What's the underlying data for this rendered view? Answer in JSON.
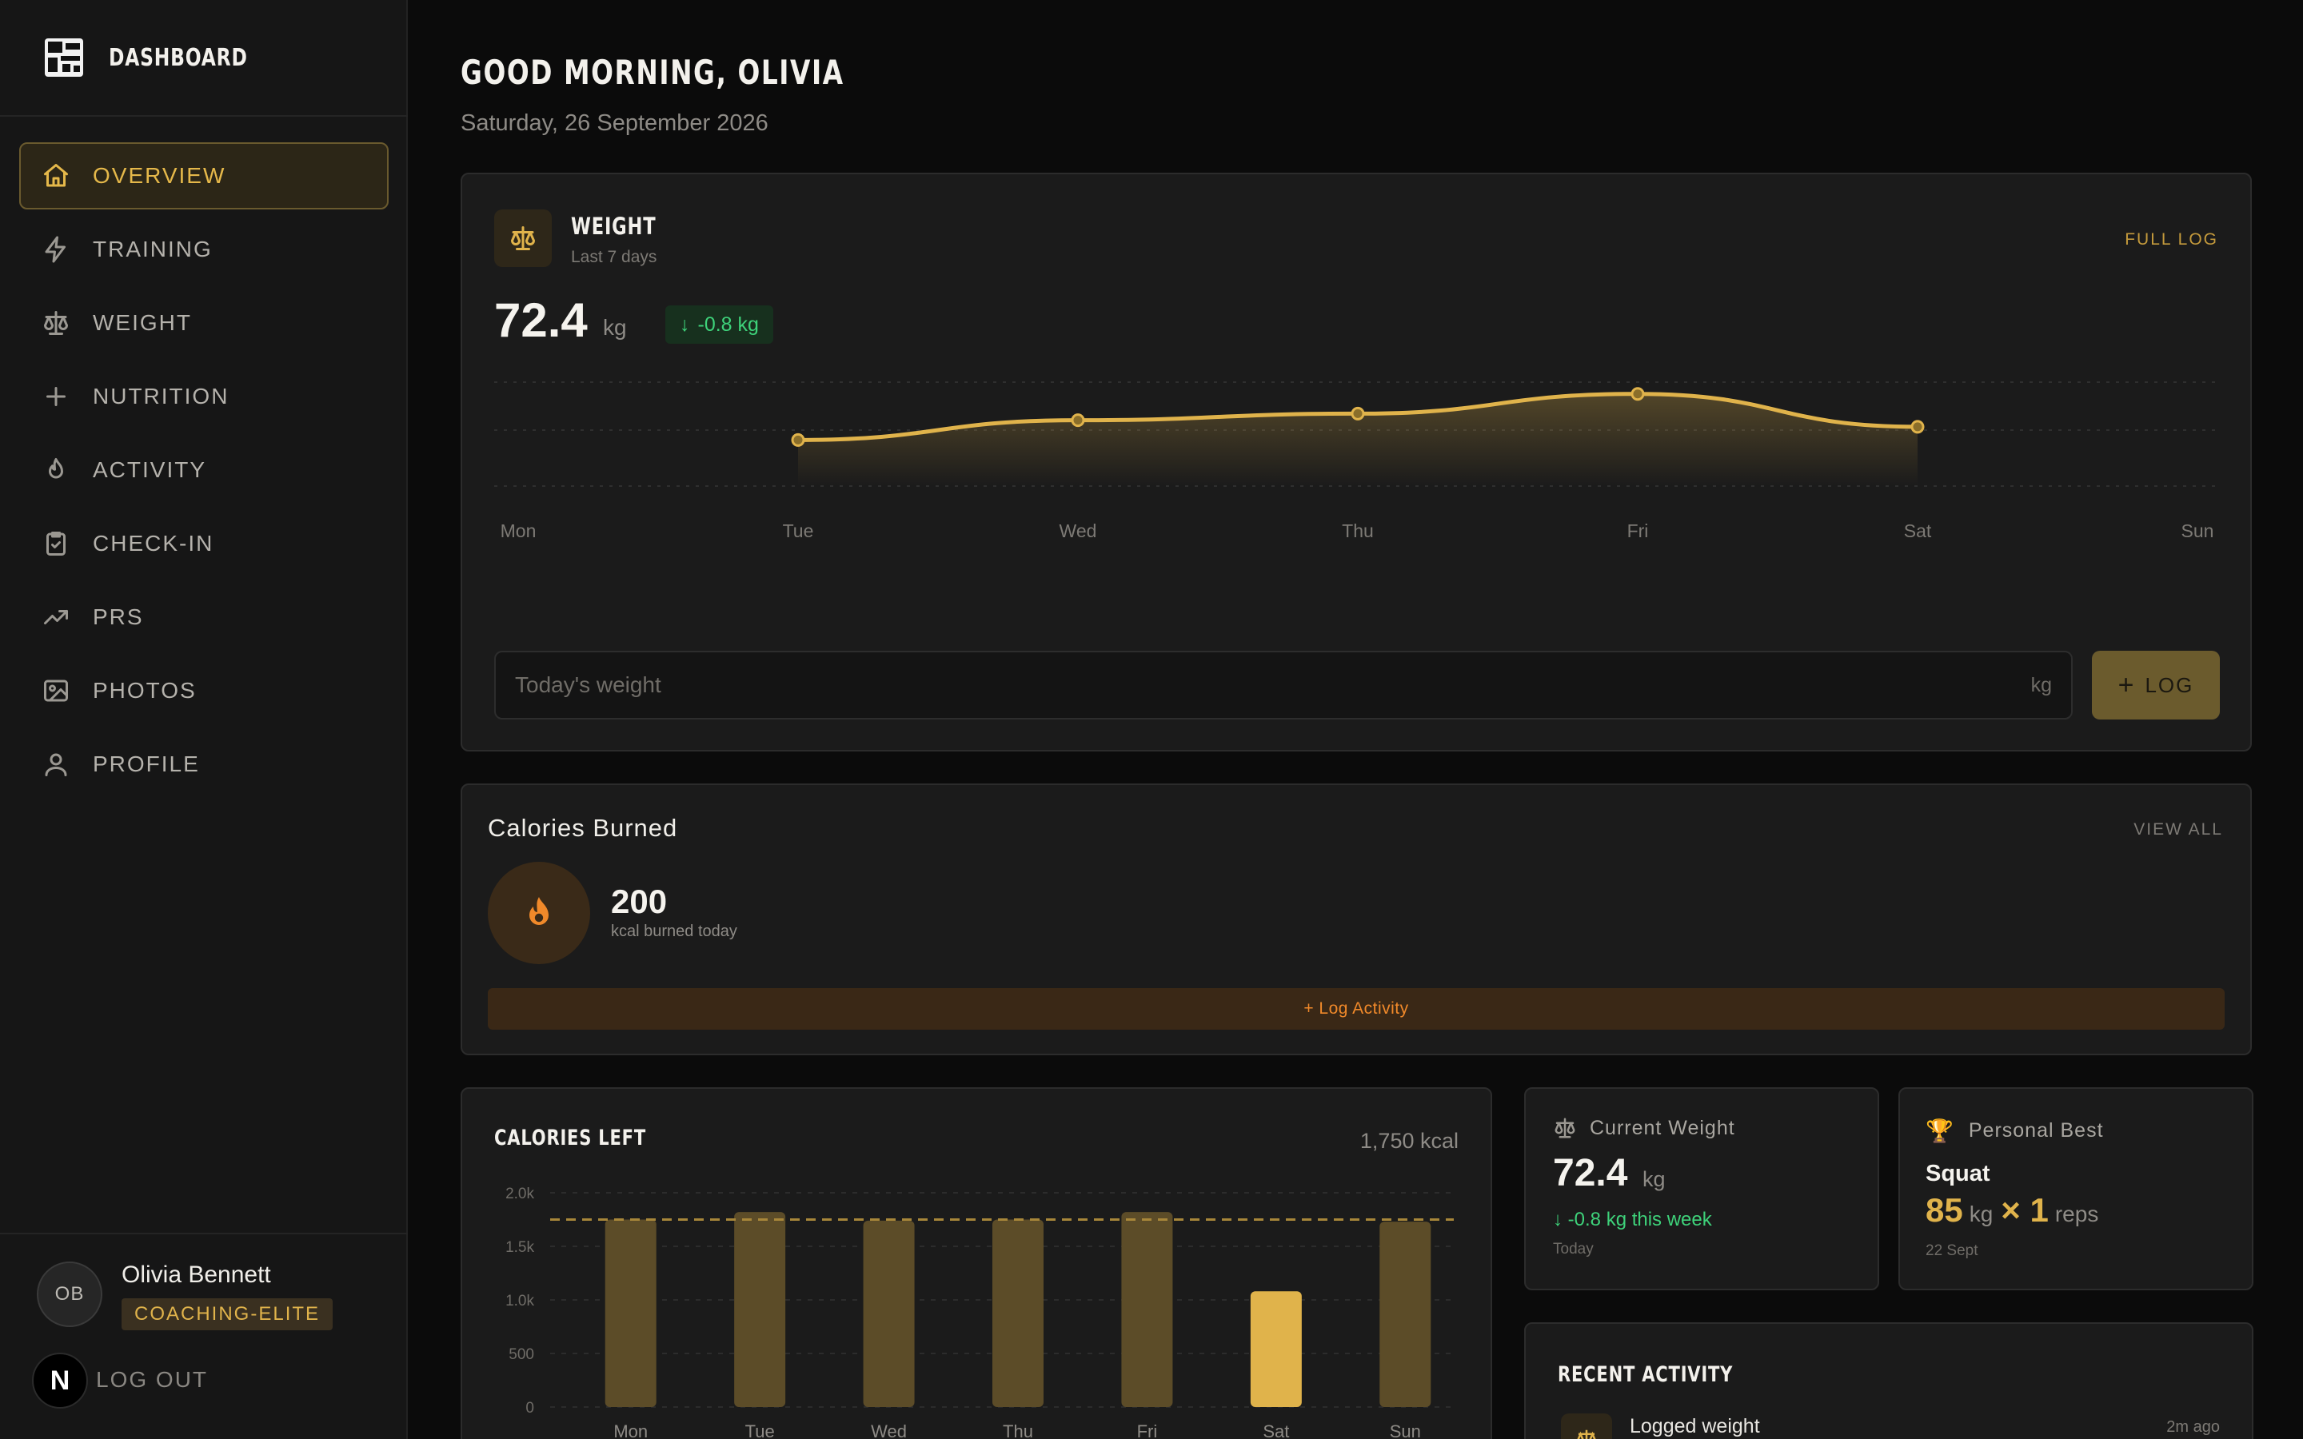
{
  "sidebar": {
    "brand_title": "DASHBOARD",
    "nav": [
      {
        "label": "OVERVIEW",
        "icon": "home-icon",
        "active": true
      },
      {
        "label": "TRAINING",
        "icon": "lightning-icon"
      },
      {
        "label": "WEIGHT",
        "icon": "scale-icon"
      },
      {
        "label": "NUTRITION",
        "icon": "plus-icon"
      },
      {
        "label": "ACTIVITY",
        "icon": "flame-icon"
      },
      {
        "label": "CHECK-IN",
        "icon": "clipboard-check-icon"
      },
      {
        "label": "PRS",
        "icon": "trending-up-icon"
      },
      {
        "label": "PHOTOS",
        "icon": "image-icon"
      },
      {
        "label": "PROFILE",
        "icon": "user-icon"
      }
    ],
    "user": {
      "initials": "OB",
      "name": "Olivia Bennett",
      "plan": "COACHING-ELITE"
    },
    "logout": {
      "badge": "N",
      "label": "LOG OUT"
    }
  },
  "header": {
    "greeting": "GOOD MORNING, OLIVIA",
    "date": "Saturday, 26 September 2026"
  },
  "weight": {
    "title": "WEIGHT",
    "subtitle": "Last 7 days",
    "full_log": "FULL LOG",
    "value": "72.4",
    "unit": "kg",
    "delta": "-0.8 kg",
    "input_placeholder": "Today's weight",
    "input_unit": "kg",
    "log_label": "LOG"
  },
  "calories_burned": {
    "title": "Calories Burned",
    "view_all": "VIEW ALL",
    "value": "200",
    "sub": "kcal burned today",
    "button": "+ Log Activity"
  },
  "calories_left": {
    "title": "CALORIES LEFT",
    "kcal": "1,750 kcal"
  },
  "current_weight": {
    "title": "Current Weight",
    "value": "72.4",
    "unit": "kg",
    "delta": "-0.8 kg this week",
    "date": "Today"
  },
  "personal_best": {
    "title": "Personal Best",
    "exercise": "Squat",
    "weight": "85",
    "unit": "kg",
    "times": "× 1",
    "reps_label": "reps",
    "date": "22 Sept"
  },
  "recent_activity": {
    "title": "RECENT ACTIVITY",
    "items": [
      {
        "text": "Logged weight",
        "time": "2m ago"
      }
    ]
  },
  "colors": {
    "accent": "#e0b34b",
    "accent_muted": "#5c4c28",
    "positive": "#3ed27a",
    "flame": "#f0892a"
  },
  "chart_data": [
    {
      "type": "line",
      "x": [
        "Mon",
        "Tue",
        "Wed",
        "Thu",
        "Fri",
        "Sat",
        "Sun"
      ],
      "series": [
        {
          "values": [
            null,
            72.9,
            73.2,
            73.3,
            73.6,
            73.1,
            null
          ]
        }
      ],
      "grid": true
    },
    {
      "type": "bar",
      "categories": [
        "Mon",
        "Tue",
        "Wed",
        "Thu",
        "Fri",
        "Sat",
        "Sun"
      ],
      "values": [
        1750,
        1820,
        1740,
        1750,
        1820,
        1080,
        1730
      ],
      "highlight_index": 5,
      "target": 1750,
      "yticks": [
        "0",
        "500",
        "1.0k",
        "1.5k",
        "2.0k"
      ],
      "ylim": [
        0,
        2000
      ],
      "grid": true
    }
  ]
}
